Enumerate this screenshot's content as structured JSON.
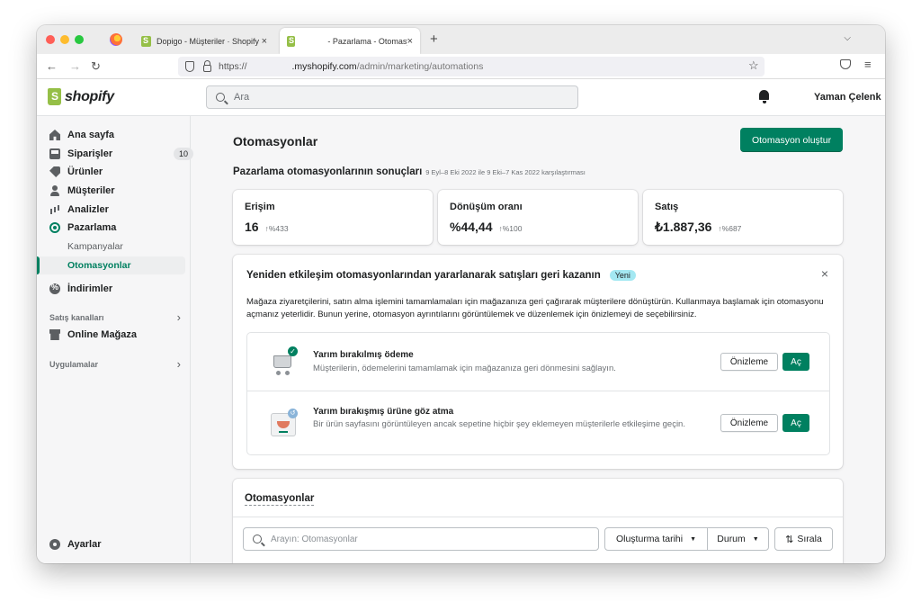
{
  "browser": {
    "tabs": [
      {
        "title": "Dopigo - Müşteriler · Shopify",
        "close": "×"
      },
      {
        "title": "- Pazarlama - Otomasyonlar",
        "close": "×"
      }
    ],
    "new_tab": "+",
    "tab_menu": "⌵",
    "nav_back": "←",
    "nav_forward": "→",
    "nav_reload": "↻",
    "url_protocol": "https://",
    "url_host": ".myshopify.com",
    "url_path": "/admin/marketing/automations",
    "bookmark": "☆",
    "menu": "≡"
  },
  "header": {
    "logo_text": "shopify",
    "search_placeholder": "Ara",
    "user_name": "Yaman Çelenk"
  },
  "sidebar": {
    "items": [
      {
        "label": "Ana sayfa",
        "icon": "home-icon"
      },
      {
        "label": "Siparişler",
        "icon": "orders-icon",
        "badge": "10"
      },
      {
        "label": "Ürünler",
        "icon": "tag-icon"
      },
      {
        "label": "Müşteriler",
        "icon": "person-icon"
      },
      {
        "label": "Analizler",
        "icon": "bar-chart-icon"
      },
      {
        "label": "Pazarlama",
        "icon": "target-icon"
      }
    ],
    "sub_items": [
      {
        "label": "Kampanyalar"
      },
      {
        "label": "Otomasyonlar",
        "active": true
      }
    ],
    "discounts": {
      "label": "İndirimler",
      "icon": "discount-icon"
    },
    "sales_channels": {
      "label": "Satış kanalları",
      "chevron": "›"
    },
    "online_store": {
      "label": "Online Mağaza",
      "icon": "store-icon"
    },
    "apps": {
      "label": "Uygulamalar",
      "chevron": "›"
    },
    "settings": {
      "label": "Ayarlar",
      "icon": "gear-icon"
    }
  },
  "main": {
    "title": "Otomasyonlar",
    "create_button": "Otomasyon oluştur",
    "results_title": "Pazarlama otomasyonlarının sonuçları",
    "results_subtitle": "9 Eyl–8 Eki 2022 ile 9 Eki–7 Kas 2022 karşılaştırması",
    "metrics": [
      {
        "label": "Erişim",
        "value": "16",
        "change": "↑%433"
      },
      {
        "label": "Dönüşüm oranı",
        "value": "%44,44",
        "change": "↑%100"
      },
      {
        "label": "Satış",
        "value": "₺1.887,36",
        "change": "↑%687"
      }
    ],
    "promo": {
      "heading": "Yeniden etkileşim otomasyonlarından yararlanarak satışları geri kazanın",
      "badge": "Yeni",
      "close": "×",
      "description": "Mağaza ziyaretçilerini, satın alma işlemini tamamlamaları için mağazanıza geri çağırarak müşterilere dönüştürün. Kullanmaya başlamak için otomasyonu açmanız yeterlidir. Bunun yerine, otomasyon ayrıntılarını görüntülemek ve düzenlemek için önizlemeyi de seçebilirsiniz.",
      "automations": [
        {
          "title": "Yarım bırakılmış ödeme",
          "description": "Müşterilerin, ödemelerini tamamlamak için mağazanıza geri dönmesini sağlayın.",
          "preview_label": "Önizleme",
          "enable_label": "Aç"
        },
        {
          "title": "Yarım bırakışmış ürüne göz atma",
          "description": "Bir ürün sayfasını görüntüleyen ancak sepetine hiçbir şey eklemeyen müşterilerle etkileşime geçin.",
          "preview_label": "Önizleme",
          "enable_label": "Aç"
        }
      ]
    },
    "list": {
      "title": "Otomasyonlar",
      "search_placeholder": "Arayın: Otomasyonlar",
      "filter_created": "Oluşturma tarihi",
      "filter_status": "Durum",
      "sort_label": "Sırala"
    }
  },
  "colors": {
    "accent": "#008060",
    "logo_green": "#95bf47",
    "badge_new": "#a4e8f2"
  }
}
